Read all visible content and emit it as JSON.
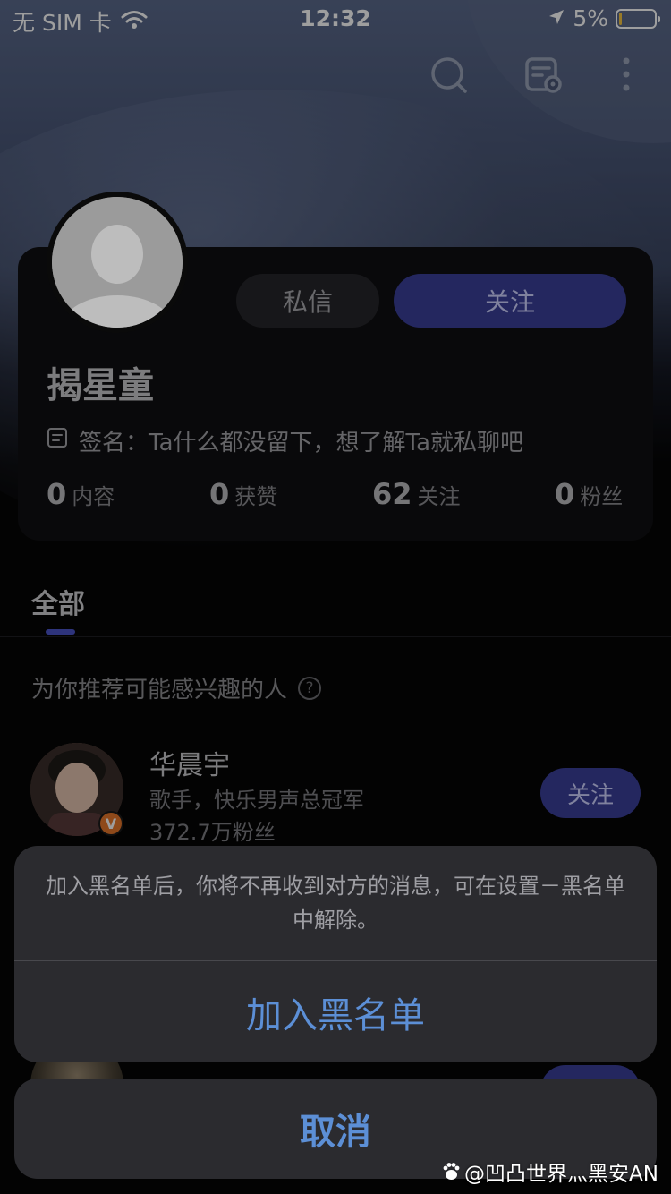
{
  "status_bar": {
    "carrier": "无 SIM 卡",
    "time": "12:32",
    "battery": "5%",
    "battery_level": 0.05
  },
  "profile": {
    "name": "揭星童",
    "signature": "签名：Ta什么都没留下，想了解Ta就私聊吧",
    "message_button": "私信",
    "follow_button": "关注",
    "stats": [
      {
        "value": "0",
        "label": "内容"
      },
      {
        "value": "0",
        "label": "获赞"
      },
      {
        "value": "62",
        "label": "关注"
      },
      {
        "value": "0",
        "label": "粉丝"
      }
    ]
  },
  "tabs": {
    "all": "全部"
  },
  "recommend": {
    "title": "为你推荐可能感兴趣的人",
    "help_symbol": "?",
    "users": [
      {
        "name": "华晨宇",
        "desc": "歌手，快乐男声总冠军",
        "fans": "372.7万粉丝",
        "badge": "V",
        "follow": "关注"
      }
    ]
  },
  "action_sheet": {
    "message": "加入黑名单后，你将不再收到对方的消息，可在设置－黑名单中解除。",
    "action": "加入黑名单",
    "cancel": "取消"
  },
  "watermark": "@凹凸世界灬黑安AN",
  "icons": {
    "search": "search-icon",
    "card": "profile-card-icon",
    "more": "more-icon",
    "location": "location-arrow-icon",
    "wifi": "wifi-icon",
    "signature": "signature-icon"
  },
  "colors": {
    "accent": "#3a3f9a",
    "sheet_action": "#5c8fd6",
    "battery": "#f5c542"
  }
}
